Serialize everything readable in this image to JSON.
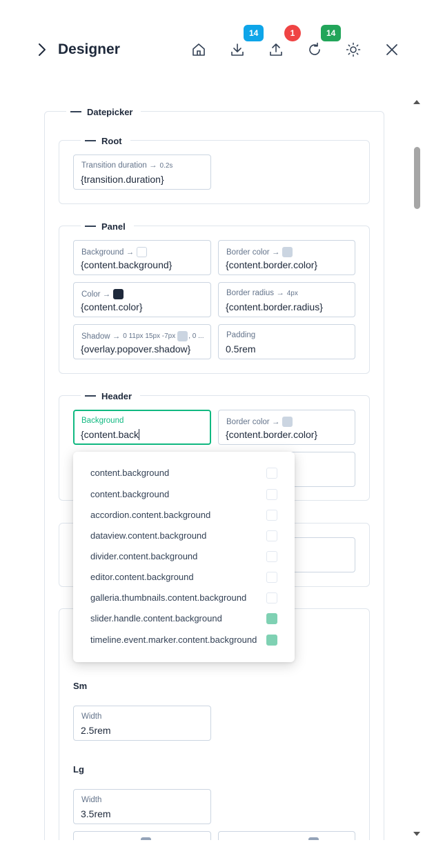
{
  "header": {
    "title": "Designer",
    "badges": {
      "download": "14",
      "upload": "1",
      "refresh": "14"
    },
    "badge_colors": {
      "download": "#0ea5e9",
      "upload": "#ef4444",
      "refresh": "#22a55a"
    },
    "icons": [
      "chevron-right-icon",
      "home-icon",
      "download-icon",
      "upload-icon",
      "refresh-icon",
      "sun-icon",
      "close-icon"
    ]
  },
  "datepicker": {
    "legend": "Datepicker",
    "root": {
      "legend": "Root",
      "transition": {
        "label": "Transition duration →",
        "note": "0.2s",
        "value": "{transition.duration}"
      }
    },
    "panel": {
      "legend": "Panel",
      "background": {
        "label": "Background →",
        "value": "{content.background}",
        "swatch": "#ffffff"
      },
      "border_color": {
        "label": "Border color →",
        "value": "{content.border.color}",
        "swatch": "#cbd5e1"
      },
      "color": {
        "label": "Color →",
        "value": "{content.color}",
        "swatch": "#1e293b"
      },
      "border_radius": {
        "label": "Border radius →",
        "note": "4px",
        "value": "{content.border.radius}"
      },
      "shadow": {
        "label": "Shadow →",
        "note": "0 11px 15px -7px",
        "note2": ", 0 ...",
        "value": "{overlay.popover.shadow}",
        "swatch": "#cbd5e1"
      },
      "padding": {
        "label": "Padding",
        "value": "0.5rem"
      }
    },
    "header": {
      "legend": "Header",
      "background": {
        "label": "Background",
        "value": "{content.back"
      },
      "border_color": {
        "label": "Border color →",
        "value": "{content.border.color}",
        "swatch": "#cbd5e1"
      }
    },
    "sm": {
      "label": "Sm",
      "width": {
        "label": "Width",
        "value": "2.5rem"
      }
    },
    "lg": {
      "label": "Lg",
      "width": {
        "label": "Width",
        "value": "3.5rem"
      }
    }
  },
  "suggestions": [
    {
      "text": "content.background",
      "color": "#ffffff"
    },
    {
      "text": "content.background",
      "color": "#ffffff"
    },
    {
      "text": "accordion.content.background",
      "color": "#ffffff"
    },
    {
      "text": "dataview.content.background",
      "color": "#ffffff"
    },
    {
      "text": "divider.content.background",
      "color": "#ffffff"
    },
    {
      "text": "editor.content.background",
      "color": "#ffffff"
    },
    {
      "text": "galleria.thumbnails.content.background",
      "color": "#ffffff"
    },
    {
      "text": "slider.handle.content.background",
      "color": "#7fd1b3"
    },
    {
      "text": "timeline.event.marker.content.background",
      "color": "#7fd1b3"
    }
  ]
}
